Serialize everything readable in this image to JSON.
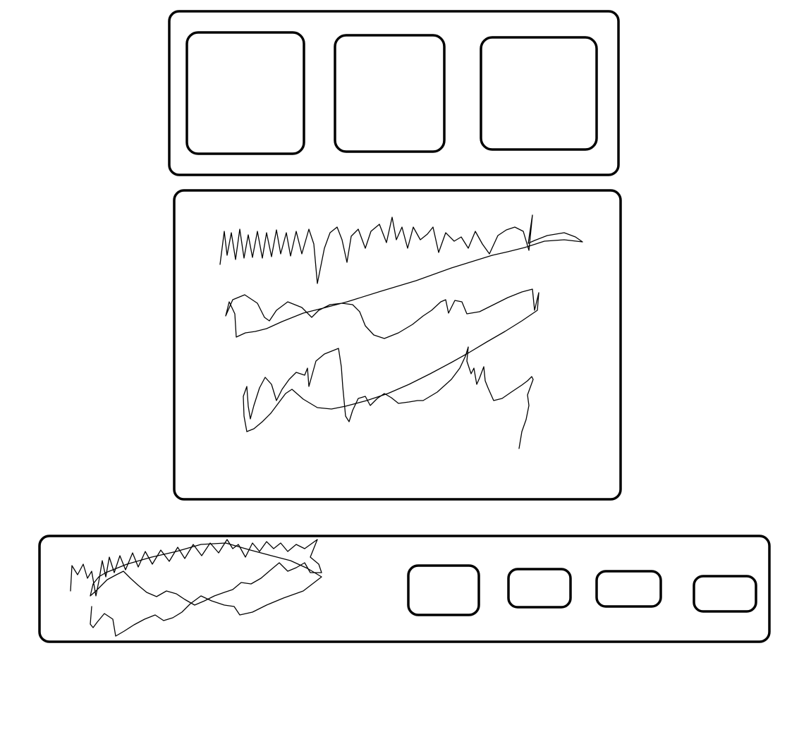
{
  "diagram": {
    "stroke_color": "#000000",
    "background_color": "#ffffff",
    "top_panel": {
      "thumbnails": [
        {
          "id": "thumb-1"
        },
        {
          "id": "thumb-2"
        },
        {
          "id": "thumb-3"
        }
      ]
    },
    "content_panel": {
      "text_lines": [
        {
          "id": "line-1"
        },
        {
          "id": "line-2"
        },
        {
          "id": "line-3"
        }
      ]
    },
    "bottom_bar": {
      "text_block": {
        "id": "caption"
      },
      "buttons": [
        {
          "id": "btn-1"
        },
        {
          "id": "btn-2"
        },
        {
          "id": "btn-3"
        },
        {
          "id": "btn-4"
        }
      ]
    }
  }
}
